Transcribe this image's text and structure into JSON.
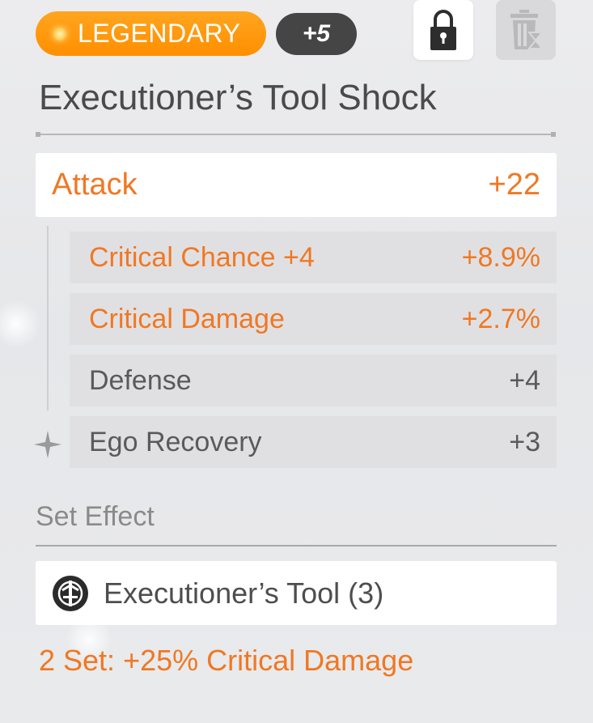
{
  "header": {
    "rarity_label": "LEGENDARY",
    "enhance_label": "+5"
  },
  "icons": {
    "rarity": "gem-dot-icon",
    "lock": "lock-icon",
    "delete": "trash-hourglass-icon",
    "set": "set-emblem-icon",
    "sparkle": "sparkle-icon"
  },
  "item": {
    "title": "Executioner’s Tool Shock"
  },
  "main_stat": {
    "label": "Attack",
    "value": "+22"
  },
  "sub_stats": [
    {
      "label": "Critical Chance +4",
      "value": "+8.9%"
    },
    {
      "label": "Critical Damage",
      "value": "+2.7%"
    },
    {
      "label": "Defense",
      "value": "+4"
    },
    {
      "label": "Ego Recovery",
      "value": "+3"
    }
  ],
  "set_effect": {
    "heading": "Set Effect",
    "set_name": "Executioner’s Tool (3)",
    "bonus": "2 Set: +25% Critical Damage"
  },
  "colors": {
    "accent": "#f07823",
    "rarity": "#ff9a0e",
    "badge": "#454545"
  }
}
